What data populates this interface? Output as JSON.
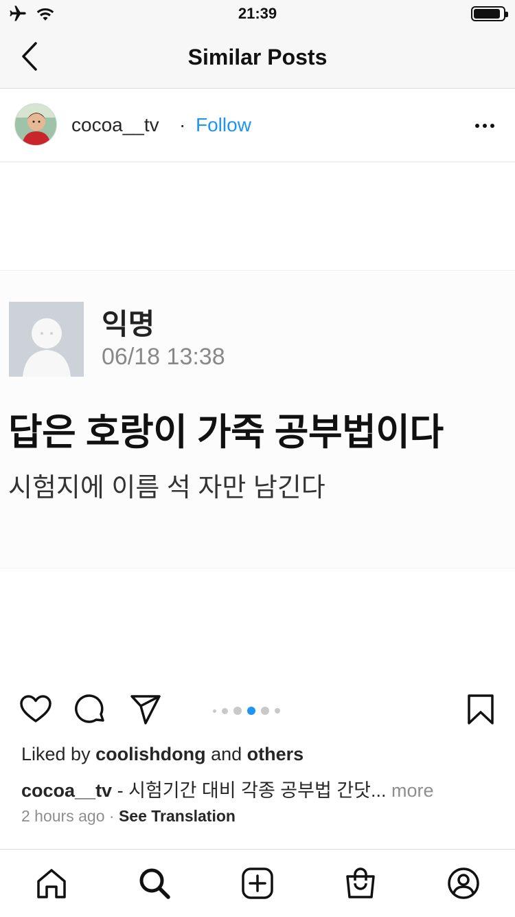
{
  "status_bar": {
    "time": "21:39"
  },
  "nav": {
    "title": "Similar Posts"
  },
  "post": {
    "username": "cocoa__tv",
    "separator": "·",
    "follow_label": "Follow",
    "image": {
      "anon_name": "익명",
      "date": "06/18 13:38",
      "headline": "답은 호랑이 가죽 공부법이다",
      "subtext": "시험지에 이름 석 자만 남긴다"
    },
    "carousel": {
      "total": 5,
      "active_index": 3
    },
    "likes": {
      "prefix": "Liked by",
      "user": "coolishdong",
      "connector": "and",
      "others": "others"
    },
    "caption": {
      "username": "cocoa__tv",
      "text": " - 시험기간 대비 각종 공부법 간닷...",
      "more": "more"
    },
    "meta": {
      "time_ago": "2 hours ago",
      "separator": "·",
      "translate": "See Translation"
    }
  },
  "colors": {
    "accent": "#1f95f2",
    "text": "#262626",
    "muted": "#8e8e8e"
  },
  "icons": {
    "status": [
      "airplane-icon",
      "wifi-icon",
      "battery-icon"
    ],
    "actions": [
      "heart-icon",
      "comment-icon",
      "share-icon",
      "bookmark-icon"
    ],
    "tabs": [
      "home-icon",
      "search-icon",
      "add-icon",
      "shop-icon",
      "profile-icon"
    ]
  }
}
